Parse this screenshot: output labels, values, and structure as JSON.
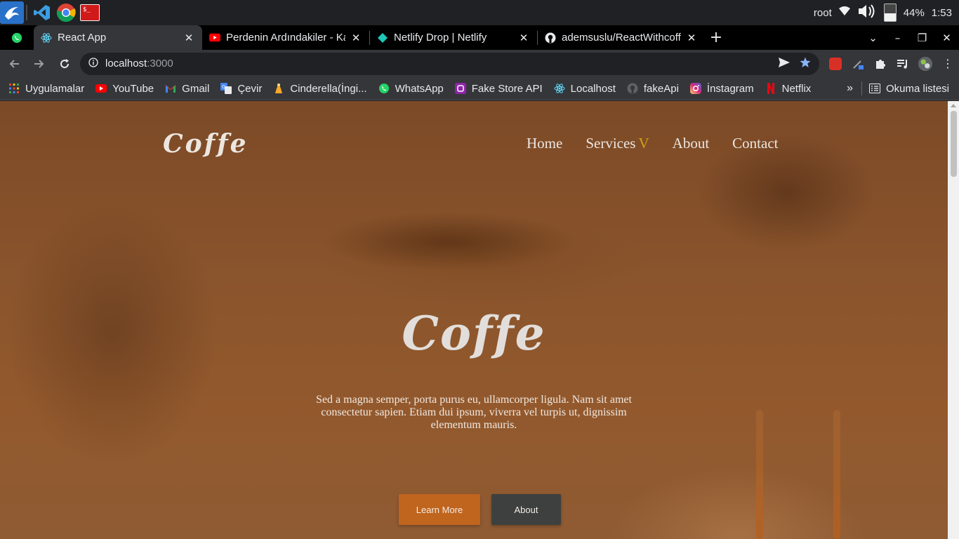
{
  "os": {
    "user": "root",
    "battery_percent": 44,
    "battery_label": "44%",
    "time": "1:53",
    "colors": {
      "kali": "#2a71c9",
      "vscode": "#3c9de0",
      "terminal": "#d01a1a"
    }
  },
  "tabs": [
    {
      "pinned": true,
      "favicon": "whatsapp-icon"
    },
    {
      "title": "React App",
      "favicon": "react-icon",
      "active": true
    },
    {
      "title": "Perdenin Ardındakiler - Ka",
      "favicon": "youtube-icon"
    },
    {
      "title": "Netlify Drop | Netlify",
      "favicon": "netlify-icon"
    },
    {
      "title": "ademsuslu/ReactWithcoffe",
      "favicon": "github-icon"
    }
  ],
  "omnibox": {
    "host": "localhost",
    "port": ":3000"
  },
  "bookmarks": [
    {
      "label": "Uygulamalar",
      "icon": "apps-grid-icon"
    },
    {
      "label": "YouTube",
      "icon": "youtube-icon"
    },
    {
      "label": "Gmail",
      "icon": "gmail-icon"
    },
    {
      "label": "Çevir",
      "icon": "translate-icon"
    },
    {
      "label": "Cinderella(İngi...",
      "icon": "cinderella-icon"
    },
    {
      "label": "WhatsApp",
      "icon": "whatsapp-icon"
    },
    {
      "label": "Fake Store API",
      "icon": "fakestore-icon"
    },
    {
      "label": "Localhost",
      "icon": "react-icon"
    },
    {
      "label": "fakeApi",
      "icon": "github-icon"
    },
    {
      "label": "İnstagram",
      "icon": "instagram-icon"
    },
    {
      "label": "Netflix",
      "icon": "netflix-icon"
    }
  ],
  "bookmarks_more": "»",
  "reading_list": "Okuma listesi",
  "site": {
    "logo": "Coffe",
    "nav": {
      "home": "Home",
      "services": "Services",
      "services_caret": "V",
      "about": "About",
      "contact": "Contact"
    },
    "hero_title": "Coffe",
    "hero_text": "Sed a magna semper, porta purus eu, ullamcorper ligula. Nam sit amet consectetur sapien. Etiam dui ipsum, viverra vel turpis ut, dignissim elementum mauris.",
    "btn_primary": "Learn More",
    "btn_secondary": "About",
    "colors": {
      "accent": "#c0651e",
      "caret": "#d4a017",
      "secondary_btn": "#3d403f"
    }
  }
}
